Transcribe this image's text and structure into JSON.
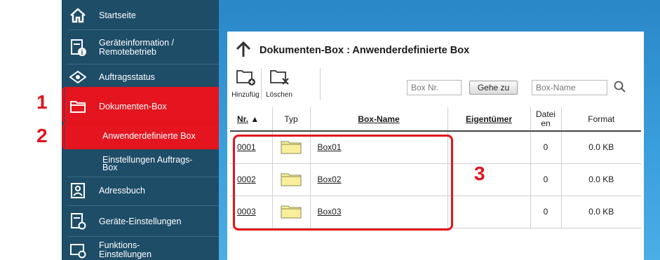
{
  "callouts": [
    "1",
    "2",
    "3"
  ],
  "sidebar": {
    "items": [
      {
        "label": "Startseite",
        "icon": "home-icon"
      },
      {
        "label_line1": "Geräteinformation /",
        "label_line2": "Remotebetrieb",
        "icon": "device-info-icon"
      },
      {
        "label": "Auftragsstatus",
        "icon": "eye-icon"
      },
      {
        "label": "Dokumenten-Box",
        "icon": "folder-icon"
      },
      {
        "label": "Anwenderdefinierte Box"
      },
      {
        "label_line1": "Einstellungen Auftrags-",
        "label_line2": "Box"
      },
      {
        "label": "Adressbuch",
        "icon": "address-book-icon"
      },
      {
        "label": "Geräte-Einstellungen",
        "icon": "device-settings-icon"
      },
      {
        "label_line1": "Funktions-",
        "label_line2": "Einstellungen",
        "icon": "function-settings-icon"
      }
    ]
  },
  "panel": {
    "title": "Dokumenten-Box : Anwenderdefinierte Box",
    "toolbar": {
      "add_label": "Hinzufüg",
      "delete_label": "Löschen"
    },
    "box_nr_placeholder": "Box Nr.",
    "go_label": "Gehe zu",
    "box_name_placeholder": "Box-Name"
  },
  "table": {
    "headers": {
      "nr": "Nr.",
      "nr_sort": "▲",
      "typ": "Typ",
      "name": "Box-Name",
      "owner": "Eigentümer",
      "datei_line1": "Datei",
      "datei_line2": "en",
      "format": "Format"
    },
    "rows": [
      {
        "nr": "0001",
        "name": "Box01",
        "owner": "",
        "files": "0",
        "size": "0.0 KB"
      },
      {
        "nr": "0002",
        "name": "Box02",
        "owner": "",
        "files": "0",
        "size": "0.0 KB"
      },
      {
        "nr": "0003",
        "name": "Box03",
        "owner": "",
        "files": "0",
        "size": "0.0 KB"
      }
    ]
  },
  "colors": {
    "sidebar": "#1e4d68",
    "highlight": "#e4151f",
    "callout": "#e3131b",
    "folder": "#f9ee9b"
  }
}
